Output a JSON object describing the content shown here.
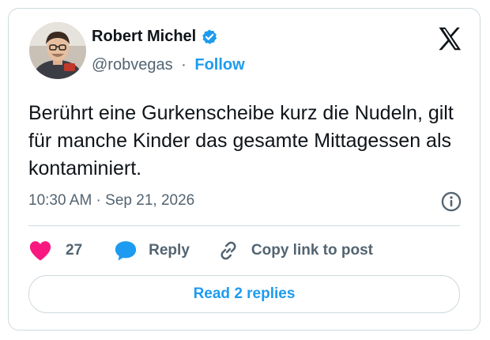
{
  "author": {
    "name": "Robert Michel",
    "handle": "@robvegas",
    "separator": "·",
    "follow_label": "Follow",
    "verified_icon": "verified-badge-icon",
    "avatar_icon": "avatar"
  },
  "post": {
    "text": "Berührt eine Gurkenscheibe kurz die Nudeln, gilt für manche Kinder das gesamte Mittagessen als kontaminiert.",
    "timestamp": "10:30 AM · Sep 21, 2026"
  },
  "actions": {
    "like_count": "27",
    "reply_label": "Reply",
    "copy_label": "Copy link to post"
  },
  "read_replies_label": "Read 2 replies",
  "colors": {
    "accent": "#1d9bf0",
    "like": "#f91880",
    "muted": "#536471",
    "border": "#cfd9de"
  }
}
